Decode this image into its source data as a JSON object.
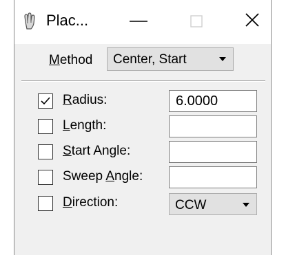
{
  "window": {
    "title": "Plac...",
    "icon": "place-arc-tool-icon",
    "controls": {
      "minimize": "minimize-icon",
      "maximize": "maximize-icon",
      "close": "close-icon"
    }
  },
  "method": {
    "label_first": "M",
    "label_rest": "ethod",
    "value": "Center, Start"
  },
  "params": [
    {
      "label_pre": "",
      "label_ul": "R",
      "label_post": "adius:",
      "checked": true,
      "value": "6.0000"
    },
    {
      "label_pre": "",
      "label_ul": "L",
      "label_post": "ength:",
      "checked": false,
      "value": ""
    },
    {
      "label_pre": "",
      "label_ul": "S",
      "label_post": "tart Angle:",
      "checked": false,
      "value": ""
    },
    {
      "label_pre": "Sweep ",
      "label_ul": "A",
      "label_post": "ngle:",
      "checked": false,
      "value": ""
    },
    {
      "label_pre": "",
      "label_ul": "D",
      "label_post": "irection:",
      "checked": false,
      "value": "CCW"
    }
  ]
}
